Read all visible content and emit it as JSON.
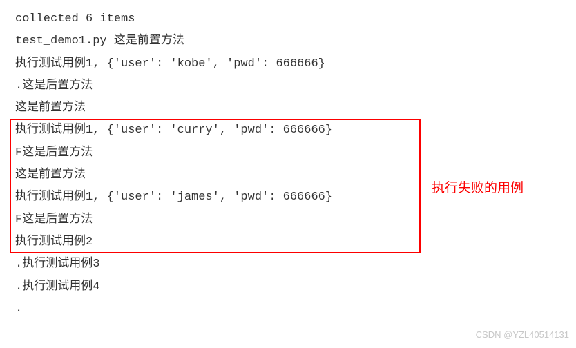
{
  "output": {
    "lines": [
      "collected 6 items",
      "",
      "test_demo1.py 这是前置方法",
      "执行测试用例1, {'user': 'kobe', 'pwd': 666666}",
      ".这是后置方法",
      "这是前置方法",
      "执行测试用例1, {'user': 'curry', 'pwd': 666666}",
      "F这是后置方法",
      "这是前置方法",
      "执行测试用例1, {'user': 'james', 'pwd': 666666}",
      "F这是后置方法",
      "执行测试用例2",
      ".执行测试用例3",
      ".执行测试用例4",
      "."
    ]
  },
  "annotation_text": "执行失败的用例",
  "watermark_text": "CSDN @YZL40514131"
}
